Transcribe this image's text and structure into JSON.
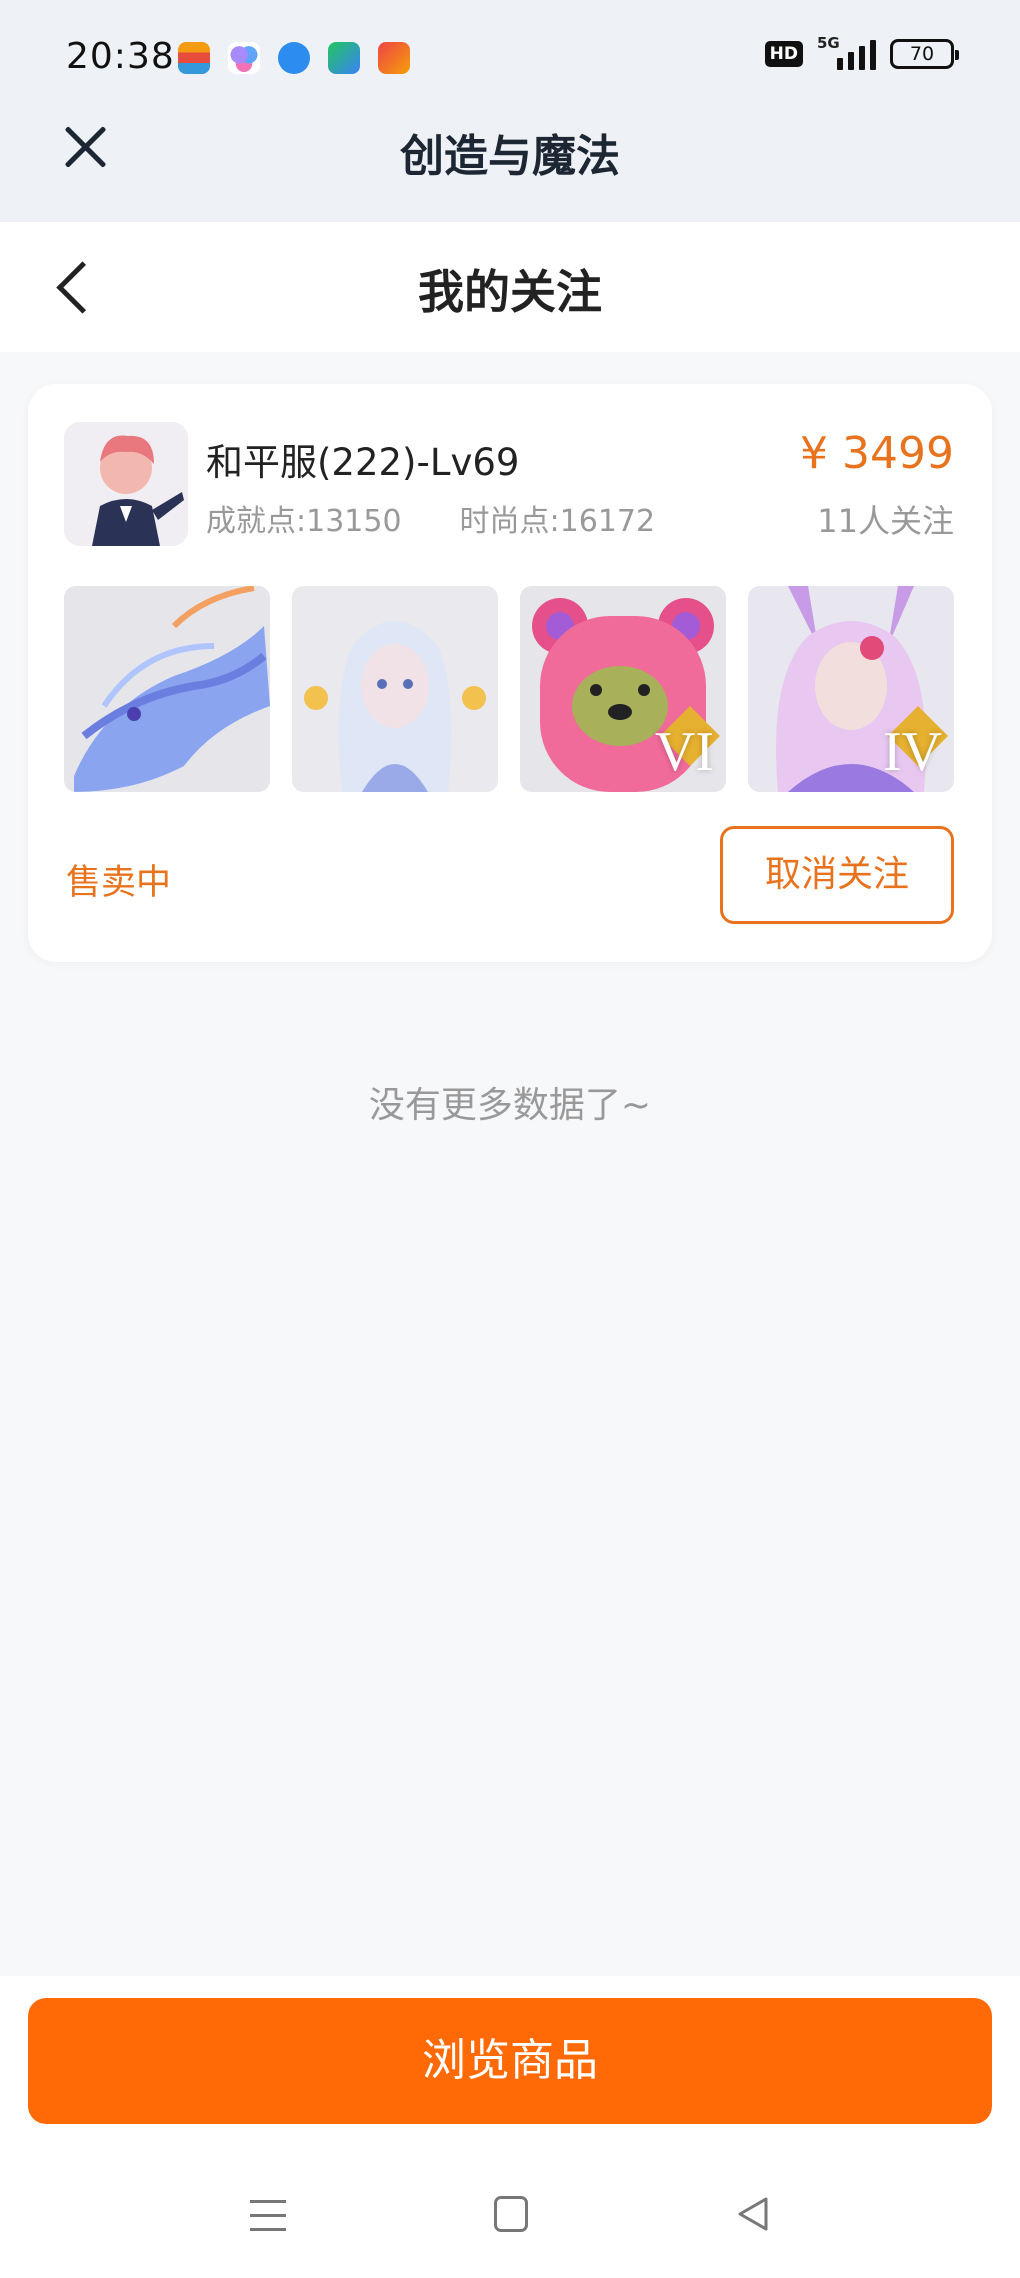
{
  "status_bar": {
    "time": "20:38",
    "hd": "HD",
    "network": "5G",
    "battery": "70"
  },
  "top_nav": {
    "title": "创造与魔法"
  },
  "page": {
    "title": "我的关注"
  },
  "card": {
    "name": "和平服(222)-Lv69",
    "achievement": "成就点:13150",
    "fashion": "时尚点:16172",
    "price": "¥ 3499",
    "followers": "11人关注",
    "thumb_ranks": [
      "VI",
      "IV"
    ],
    "status": "售卖中",
    "unfollow_label": "取消关注"
  },
  "no_more_text": "没有更多数据了~",
  "bottom_button": "浏览商品",
  "colors": {
    "accent": "#e8731e",
    "primary_button": "#ff6a07"
  }
}
